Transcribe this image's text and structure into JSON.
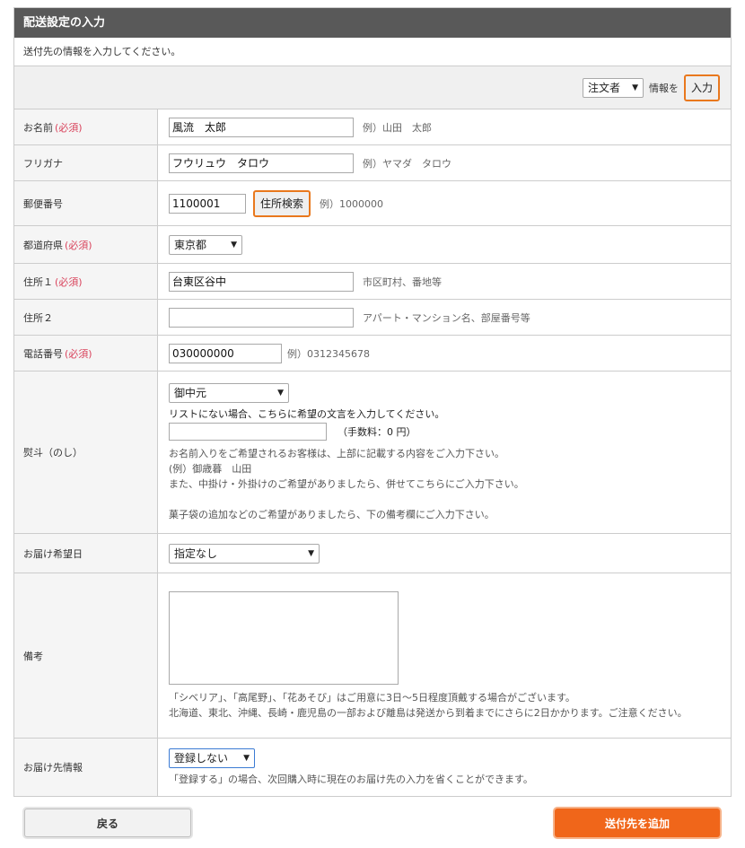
{
  "panel": {
    "title": "配送設定の入力",
    "intro": "送付先の情報を入力してください。"
  },
  "copy": {
    "select_value": "注文者",
    "text": "情報を",
    "button": "入力"
  },
  "required_mark": "(必須)",
  "fields": {
    "name": {
      "label": "お名前",
      "value": "風流　太郎",
      "hint": "例）山田　太郎"
    },
    "kana": {
      "label": "フリガナ",
      "value": "フウリュウ　タロウ",
      "hint": "例）ヤマダ　タロウ"
    },
    "zip": {
      "label": "郵便番号",
      "value": "1100001",
      "button": "住所検索",
      "hint": "例）1000000"
    },
    "pref": {
      "label": "都道府県",
      "value": "東京都"
    },
    "addr1": {
      "label": "住所１",
      "value": "台東区谷中",
      "hint": "市区町村、番地等"
    },
    "addr2": {
      "label": "住所２",
      "value": "",
      "hint": "アパート・マンション名、部屋番号等"
    },
    "tel": {
      "label": "電話番号",
      "value": "030000000",
      "hint": "例）0312345678"
    },
    "noshi": {
      "label": "熨斗（のし）",
      "select_value": "御中元",
      "custom_note": "リストにない場合、こちらに希望の文言を入力してください。",
      "custom_value": "",
      "fee": "（手数料：0 円）",
      "notes": [
        "お名前入りをご希望されるお客様は、上部に記載する内容をご入力下さい。",
        "(例）御歳暮　山田",
        "また、中掛け・外掛けのご希望がありましたら、併せてこちらにご入力下さい。",
        "",
        "菓子袋の追加などのご希望がありましたら、下の備考欄にご入力下さい。"
      ]
    },
    "date": {
      "label": "お届け希望日",
      "select_value": "指定なし"
    },
    "remarks": {
      "label": "備考",
      "value": "",
      "notes": [
        "「シベリア」、「高尾野」、「花あそび」はご用意に3日〜5日程度頂戴する場合がございます。",
        "北海道、東北、沖縄、長崎・鹿児島の一部および離島は発送から到着までにさらに2日かかります。ご注意ください。"
      ]
    },
    "save": {
      "label": "お届け先情報",
      "select_value": "登録しない",
      "note": "「登録する」の場合、次回購入時に現在のお届け先の入力を省くことができます。"
    }
  },
  "buttons": {
    "back": "戻る",
    "submit": "送付先を追加"
  }
}
